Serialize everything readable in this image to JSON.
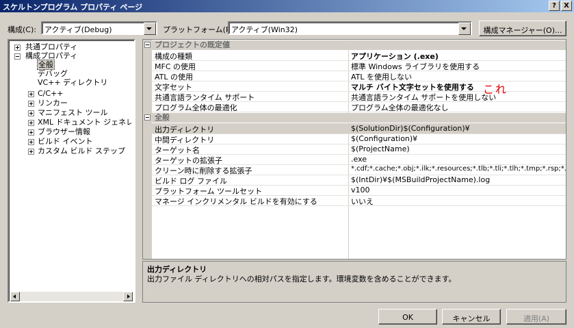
{
  "window": {
    "title": "スケルトンプログラム プロパティ ページ",
    "help_btn": "?",
    "close_btn": "X"
  },
  "toolbar": {
    "config_label": "構成(C):",
    "config_value": "アクティブ(Debug)",
    "platform_label": "プラットフォーム(P):",
    "platform_value": "アクティブ(Win32)",
    "config_manager_btn": "構成マネージャー(O)..."
  },
  "tree": {
    "items": [
      {
        "label": "共通プロパティ"
      },
      {
        "label": "構成プロパティ"
      },
      {
        "label": "全般"
      },
      {
        "label": "デバッグ"
      },
      {
        "label": "VC++ ディレクトリ"
      },
      {
        "label": "C/C++"
      },
      {
        "label": "リンカー"
      },
      {
        "label": "マニフェスト ツール"
      },
      {
        "label": "XML ドキュメント ジェネレーター"
      },
      {
        "label": "ブラウザー情報"
      },
      {
        "label": "ビルド イベント"
      },
      {
        "label": "カスタム ビルド ステップ"
      }
    ]
  },
  "grid": {
    "cat1": {
      "title": "プロジェクトの既定値",
      "rows": [
        {
          "name": "構成の種類",
          "value": "アプリケーション (.exe)"
        },
        {
          "name": "MFC の使用",
          "value": "標準 Windows ライブラリを使用する"
        },
        {
          "name": "ATL の使用",
          "value": "ATL を使用しない"
        },
        {
          "name": "文字セット",
          "value": "マルチ バイト文字セットを使用する"
        },
        {
          "name": "共通言語ランタイム サポート",
          "value": "共通言語ランタイム サポートを使用しない"
        },
        {
          "name": "プログラム全体の最適化",
          "value": "プログラム全体の最適化なし"
        }
      ]
    },
    "cat2": {
      "title": "全般",
      "rows": [
        {
          "name": "出力ディレクトリ",
          "value": "$(SolutionDir)$(Configuration)¥"
        },
        {
          "name": "中間ディレクトリ",
          "value": "$(Configuration)¥"
        },
        {
          "name": "ターゲット名",
          "value": "$(ProjectName)"
        },
        {
          "name": "ターゲットの拡張子",
          "value": ".exe"
        },
        {
          "name": "クリーン時に削除する拡張子",
          "value": "*.cdf;*.cache;*.obj;*.ilk;*.resources;*.tlb;*.tli;*.tlh;*.tmp;*.rsp;*.pe"
        },
        {
          "name": "ビルド ログ ファイル",
          "value": "$(IntDir)¥$(MSBuildProjectName).log"
        },
        {
          "name": "プラットフォーム ツールセット",
          "value": "v100"
        },
        {
          "name": "マネージ インクリメンタル ビルドを有効にする",
          "value": "いいえ"
        }
      ]
    }
  },
  "annotation": "これ",
  "description": {
    "title": "出力ディレクトリ",
    "text": "出力ファイル ディレクトリへの相対パスを指定します。環境変数を含めることができます。"
  },
  "buttons": {
    "ok": "OK",
    "cancel": "キャンセル",
    "apply": "適用(A)"
  }
}
